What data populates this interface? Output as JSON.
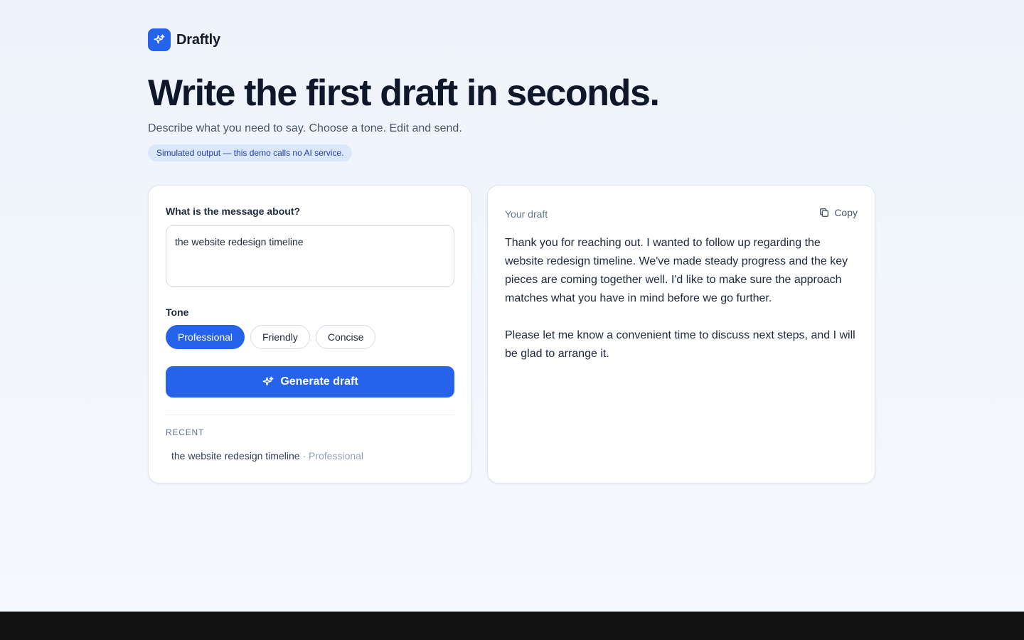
{
  "brand": {
    "name": "Draftly"
  },
  "hero": {
    "title": "Write the first draft in seconds.",
    "subtitle": "Describe what you need to say. Choose a tone. Edit and send.",
    "notice": "Simulated output — this demo calls no AI service."
  },
  "form": {
    "topic_label": "What is the message about?",
    "topic_value": "the website redesign timeline",
    "tone_label": "Tone",
    "tones": [
      "Professional",
      "Friendly",
      "Concise"
    ],
    "selected_tone": "Professional",
    "generate_label": "Generate draft"
  },
  "recent": {
    "heading": "RECENT",
    "items": [
      {
        "topic": "the website redesign timeline",
        "tone": "Professional"
      }
    ]
  },
  "draft": {
    "label": "Your draft",
    "copy_label": "Copy",
    "paragraphs": [
      "Thank you for reaching out. I wanted to follow up regarding the website redesign timeline. We've made steady progress and the key pieces are coming together well. I'd like to make sure the approach matches what you have in mind before we go further.",
      "Please let me know a convenient time to discuss next steps, and I will be glad to arrange it."
    ]
  },
  "colors": {
    "accent": "#2563eb",
    "background": "#eef3fb",
    "footer_bar": "#111111"
  },
  "icons": {
    "brand": "sparkles-icon",
    "generate": "sparkles-icon",
    "copy": "copy-icon"
  }
}
